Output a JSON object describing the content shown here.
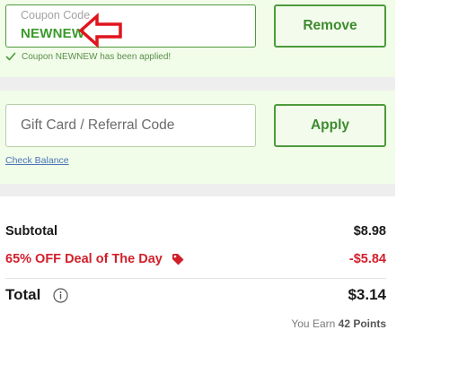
{
  "coupon": {
    "label": "Coupon Code",
    "value": "NEWNEW",
    "remove_label": "Remove",
    "applied_message": "Coupon NEWNEW has been applied!"
  },
  "gift": {
    "placeholder": "Gift Card / Referral Code",
    "apply_label": "Apply",
    "check_balance": "Check Balance"
  },
  "summary": {
    "subtotal_label": "Subtotal",
    "subtotal_value": "$8.98",
    "deal_label": "65% OFF Deal of The Day",
    "deal_value": "-$5.84",
    "total_label": "Total",
    "total_value": "$3.14",
    "points_prefix": "You Earn",
    "points_value": "42 Points"
  },
  "colors": {
    "accent_green": "#4e9a3d",
    "deal_red": "#d21f2b",
    "panel_bg": "#f1fce9",
    "annotation_arrow": "#e0141c"
  },
  "icons": [
    "check-icon",
    "tag-icon",
    "info-icon",
    "annotation-arrow-icon"
  ]
}
